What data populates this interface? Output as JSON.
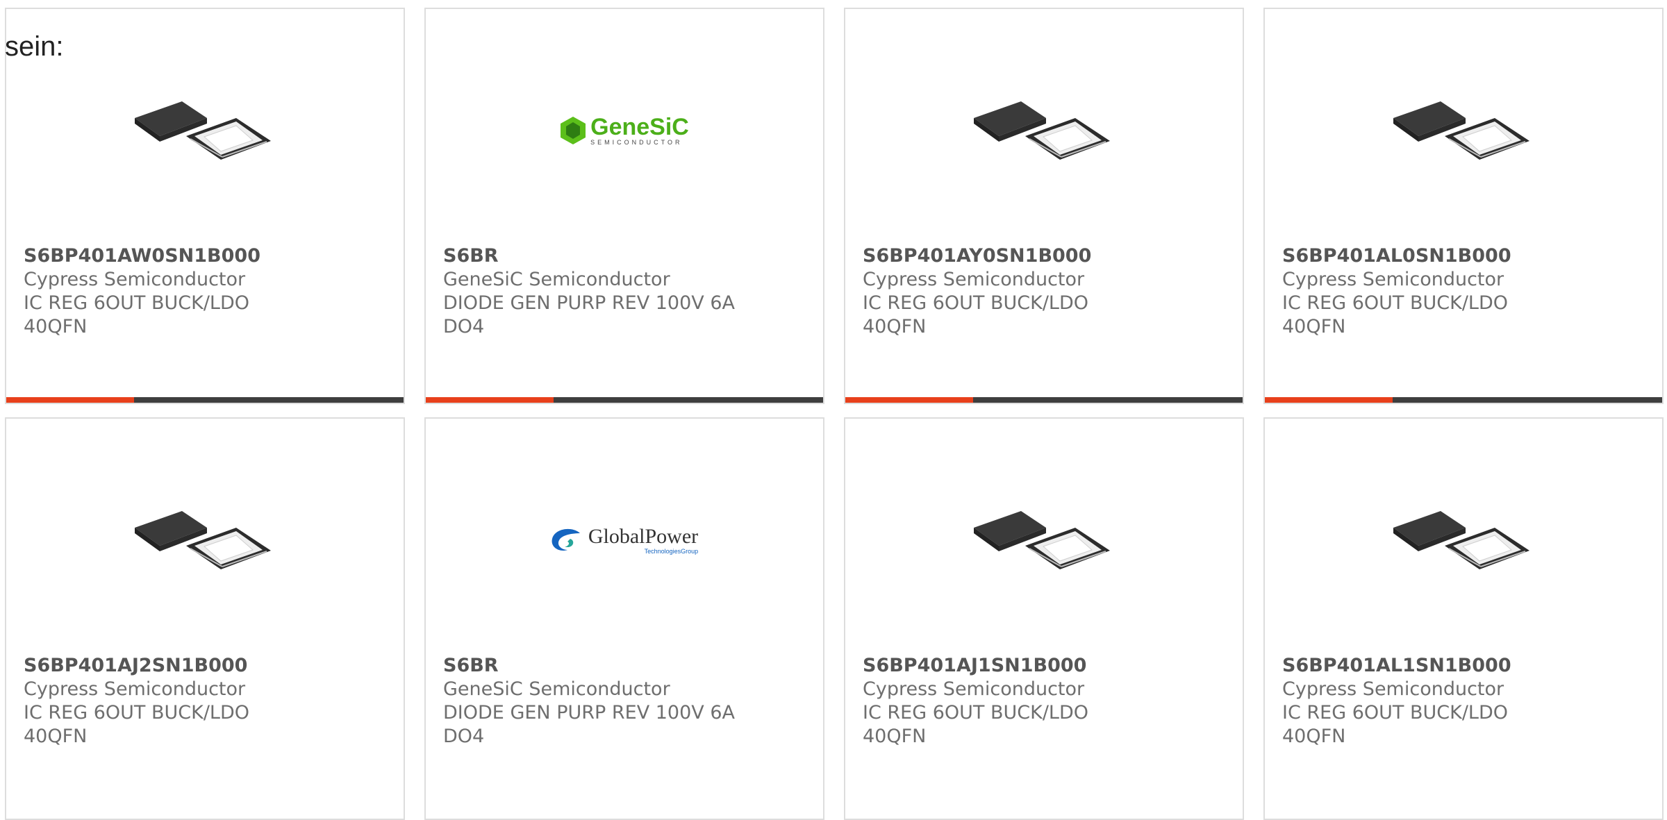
{
  "page": {
    "prefix_text": "sein:"
  },
  "colors": {
    "accent": "#e8401b",
    "bar": "#3e3e3e",
    "border": "#dddddd",
    "text": "#6e6e6e"
  },
  "cards": [
    {
      "part": "S6BP401AW0SN1B000",
      "manufacturer": "Cypress Semiconductor",
      "description": "IC REG 6OUT BUCK/LDO 40QFN",
      "image": "qfn-chip-icon"
    },
    {
      "part": "S6BR",
      "manufacturer": "GeneSiC Semiconductor",
      "description": "DIODE GEN PURP REV 100V 6A DO4",
      "image": "genesic-logo",
      "logo": {
        "name": "GeneSiC",
        "tagline": "SEMICONDUCTOR"
      }
    },
    {
      "part": "S6BP401AY0SN1B000",
      "manufacturer": "Cypress Semiconductor",
      "description": "IC REG 6OUT BUCK/LDO 40QFN",
      "image": "qfn-chip-icon"
    },
    {
      "part": "S6BP401AL0SN1B000",
      "manufacturer": "Cypress Semiconductor",
      "description": "IC REG 6OUT BUCK/LDO 40QFN",
      "image": "qfn-chip-icon"
    },
    {
      "part": "S6BP401AJ2SN1B000",
      "manufacturer": "Cypress Semiconductor",
      "description": "IC REG 6OUT BUCK/LDO 40QFN",
      "image": "qfn-chip-icon"
    },
    {
      "part": "S6BR",
      "manufacturer": "GeneSiC Semiconductor",
      "description": "DIODE GEN PURP REV 100V 6A DO4",
      "image": "globalpower-logo",
      "logo": {
        "name": "GlobalPower",
        "tagline": "TechnologiesGroup"
      }
    },
    {
      "part": "S6BP401AJ1SN1B000",
      "manufacturer": "Cypress Semiconductor",
      "description": "IC REG 6OUT BUCK/LDO 40QFN",
      "image": "qfn-chip-icon"
    },
    {
      "part": "S6BP401AL1SN1B000",
      "manufacturer": "Cypress Semiconductor",
      "description": "IC REG 6OUT BUCK/LDO 40QFN",
      "image": "qfn-chip-icon"
    }
  ]
}
